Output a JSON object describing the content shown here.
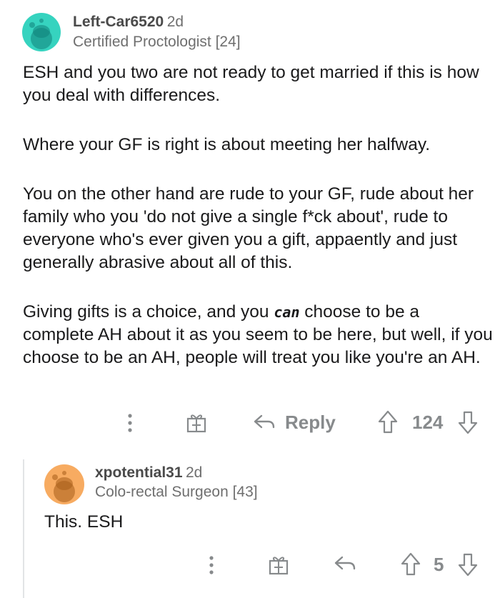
{
  "comment": {
    "username": "Left-Car6520",
    "age": "2d",
    "flair": "Certified Proctologist [24]",
    "paragraphs": [
      "ESH and you two are not ready to get married if this is how you deal with differences.",
      "Where your GF is right is about meeting her halfway.",
      "You on the other hand are rude to your GF, rude about her family who you 'do not give a single f*ck about', rude to everyone who's ever given you a gift, appaently and just generally abrasive about all of this."
    ],
    "last_paragraph": {
      "before": "Giving gifts is a choice, and you ",
      "emphasis": "can",
      "after": " choose to be a complete AH about it as you seem to be here, but well, if you choose to be an AH, people will treat you like you're an AH."
    },
    "reply_label": "Reply",
    "score": "124",
    "avatar_color": "#36d3bf"
  },
  "reply": {
    "username": "xpotential31",
    "age": "2d",
    "flair": "Colo-rectal Surgeon [43]",
    "text": "This. ESH",
    "score": "5",
    "avatar_color": "#f7ab61"
  },
  "icons": [
    "more-options-icon",
    "gift-icon",
    "reply-arrow-icon",
    "upvote-icon",
    "downvote-icon"
  ]
}
